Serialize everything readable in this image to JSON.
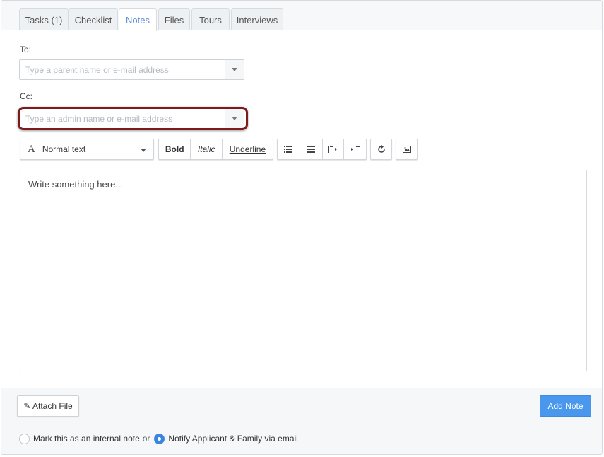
{
  "tabs": [
    {
      "label": "Tasks (1)",
      "active": false
    },
    {
      "label": "Checklist",
      "active": false
    },
    {
      "label": "Notes",
      "active": true
    },
    {
      "label": "Files",
      "active": false
    },
    {
      "label": "Tours",
      "active": false
    },
    {
      "label": "Interviews",
      "active": false
    }
  ],
  "form": {
    "to_label": "To:",
    "to_placeholder": "Type a parent name or e-mail address",
    "cc_label": "Cc:",
    "cc_placeholder": "Type an admin name or e-mail address"
  },
  "toolbar": {
    "format_icon": "A",
    "format_value": "Normal text",
    "bold": "Bold",
    "italic": "Italic",
    "underline": "Underline",
    "icons": [
      "bullet-list-icon",
      "numbered-list-icon",
      "outdent-icon",
      "indent-icon",
      "undo-icon",
      "image-icon"
    ]
  },
  "editor": {
    "placeholder": "Write something here..."
  },
  "footer": {
    "attach_label": "✎ Attach File",
    "add_note_label": "Add Note",
    "internal_note_label": "Mark this as an internal note",
    "or_text": "or",
    "notify_label": "Notify Applicant & Family via email"
  },
  "colors": {
    "accent": "#4a98ee",
    "highlight_border": "#7b1b1b",
    "active_tab_text": "#5b8dd6"
  }
}
